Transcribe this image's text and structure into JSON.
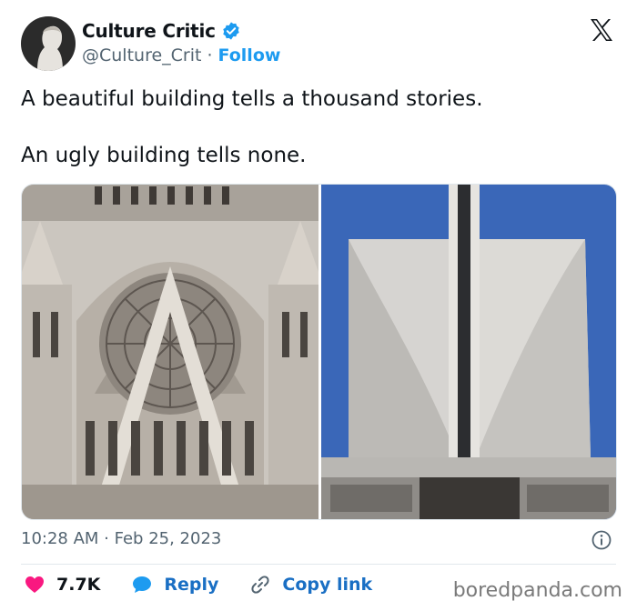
{
  "author": {
    "name": "Culture Critic",
    "handle": "@Culture_Crit",
    "separator": "·",
    "follow_label": "Follow"
  },
  "tweet": {
    "lines": [
      "A beautiful building tells a thousand stories.",
      "An ugly building tells none."
    ]
  },
  "meta": {
    "timestamp": "10:28 AM · Feb 25, 2023"
  },
  "actions": {
    "likes": "7.7K",
    "reply_label": "Reply",
    "copy_label": "Copy link"
  },
  "watermark": "boredpanda.com",
  "colors": {
    "accent": "#1d9bf0",
    "like": "#f91880",
    "sky": "#3a67b8",
    "stone": "#c9c4bd"
  },
  "icons": [
    "verified-badge-icon",
    "x-logo-icon",
    "info-icon",
    "heart-icon",
    "speech-bubble-icon",
    "link-icon"
  ]
}
